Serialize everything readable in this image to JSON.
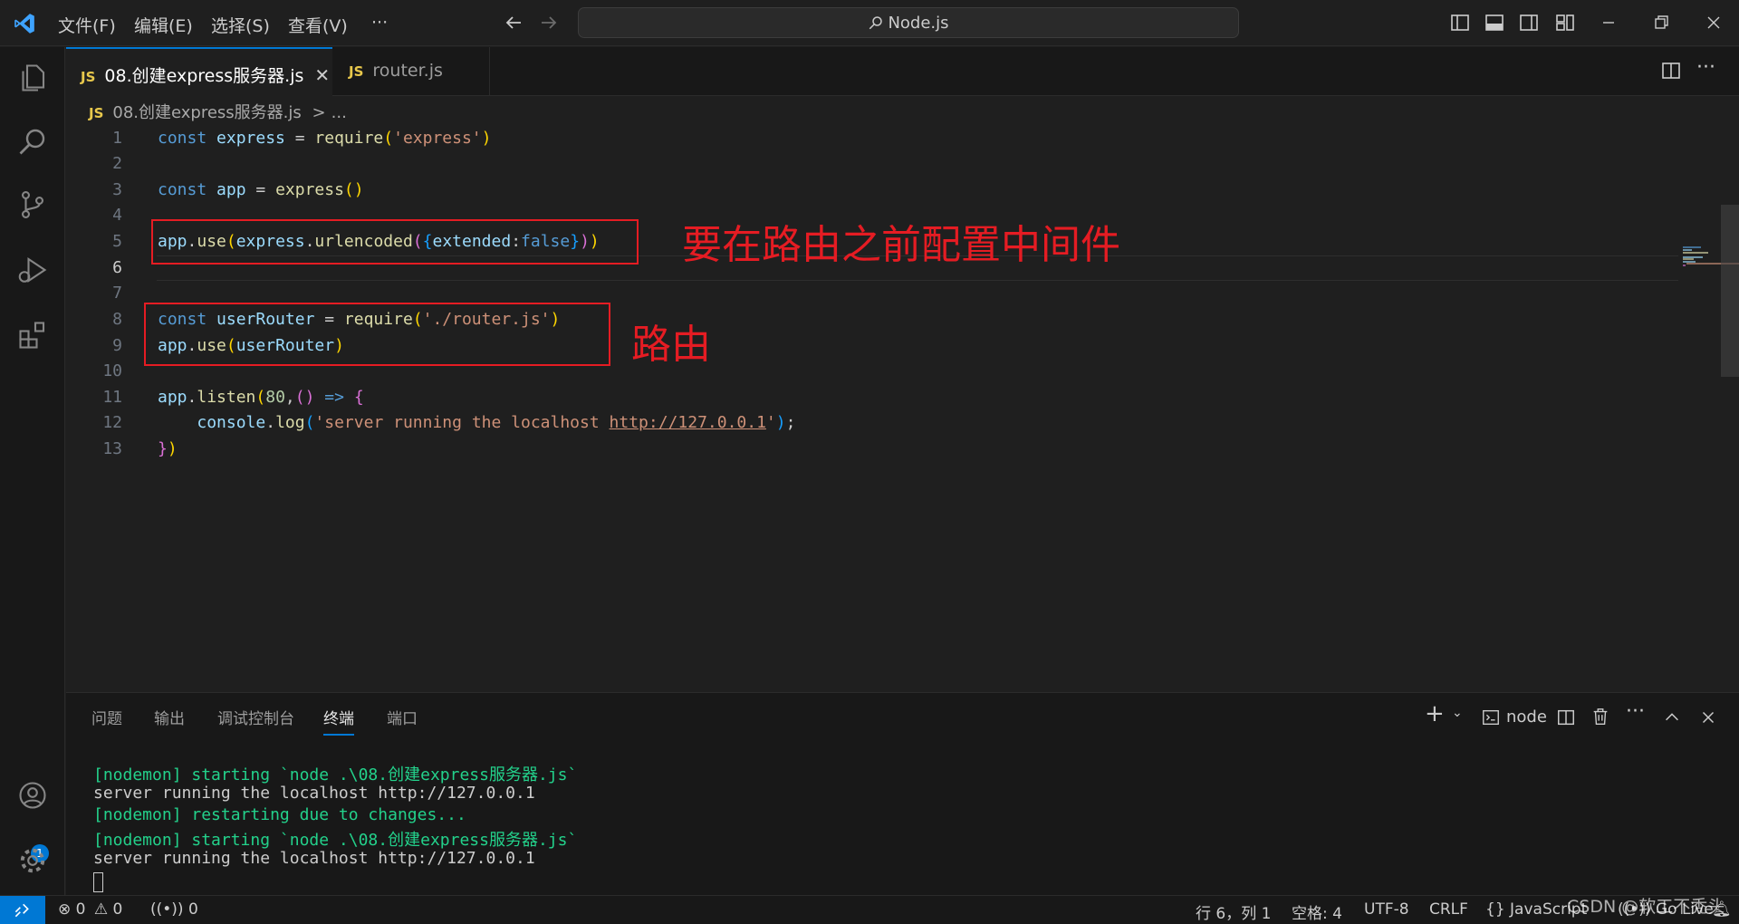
{
  "titlebar": {
    "menus": [
      "文件(F)",
      "编辑(E)",
      "选择(S)",
      "查看(V)",
      "···"
    ],
    "search": "Node.js"
  },
  "tabs": [
    {
      "icon": "JS",
      "label": "08.创建express服务器.js",
      "active": true
    },
    {
      "icon": "JS",
      "label": "router.js",
      "active": false
    }
  ],
  "breadcrumb": {
    "icon": "JS",
    "file": "08.创建express服务器.js",
    "sep": ">",
    "more": "..."
  },
  "editor": {
    "current_line": 6,
    "lines": [
      {
        "n": "1",
        "text": "const express = require('express')"
      },
      {
        "n": "2",
        "text": ""
      },
      {
        "n": "3",
        "text": "const app = express()"
      },
      {
        "n": "4",
        "text": ""
      },
      {
        "n": "5",
        "text": "app.use(express.urlencoded({extended:false}))"
      },
      {
        "n": "6",
        "text": ""
      },
      {
        "n": "7",
        "text": ""
      },
      {
        "n": "8",
        "text": "const userRouter = require('./router.js')"
      },
      {
        "n": "9",
        "text": "app.use(userRouter)"
      },
      {
        "n": "10",
        "text": ""
      },
      {
        "n": "11",
        "text": "app.listen(80,() => {"
      },
      {
        "n": "12",
        "text": "    console.log('server running the localhost http://127.0.0.1');"
      },
      {
        "n": "13",
        "text": "})"
      }
    ]
  },
  "annotations": {
    "middleware_note": "要在路由之前配置中间件",
    "router_note": "路由"
  },
  "panel": {
    "tabs": [
      "问题",
      "输出",
      "调试控制台",
      "终端",
      "端口"
    ],
    "active_tab": "终端",
    "terminal_label": "node",
    "terminal_lines": [
      {
        "text": "[nodemon] starting `node .\\08.创建express服务器.js`",
        "color": "green"
      },
      {
        "text": "server running the localhost http://127.0.0.1",
        "color": "white"
      },
      {
        "text": "[nodemon] restarting due to changes...",
        "color": "green"
      },
      {
        "text": "[nodemon] starting `node .\\08.创建express服务器.js`",
        "color": "green"
      },
      {
        "text": "server running the localhost http://127.0.0.1",
        "color": "white"
      }
    ]
  },
  "statusbar": {
    "errors": "0",
    "warnings": "0",
    "ports": "0",
    "position": "行 6，列 1",
    "spaces": "空格: 4",
    "encoding": "UTF-8",
    "eol": "CRLF",
    "language": "JavaScript",
    "golive": "Go Live"
  },
  "accounts_badge": "1",
  "watermark": "CSDN @软工不秃头",
  "colors": {
    "accent": "#0078d4",
    "annotation": "#e51c23",
    "terminal_green": "#23d18b"
  }
}
